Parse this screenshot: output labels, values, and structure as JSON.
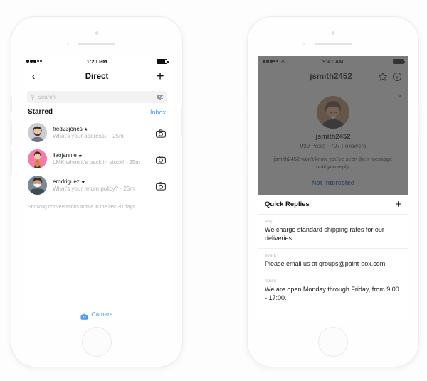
{
  "left_phone": {
    "status_bar": {
      "signal": "•••○○",
      "time": "1:20 PM",
      "battery": "battery-full"
    },
    "nav": {
      "back_icon": "chevron-left",
      "title": "Direct",
      "add_icon": "plus"
    },
    "search": {
      "placeholder": "Search",
      "value": "",
      "icon": "search-icon",
      "filter_icon": "tune-icon"
    },
    "section": {
      "title": "Starred",
      "link": "Inbox"
    },
    "conversations": [
      {
        "username": "fred23jones",
        "star": "★",
        "preview": "What's your address? · 25m",
        "action_icon": "camera-icon"
      },
      {
        "username": "liaojannie",
        "star": "★",
        "preview": "LMK when it's back in stock! · 25m",
        "action_icon": "camera-icon"
      },
      {
        "username": "erodriguez",
        "star": "★",
        "preview": "What's your return policy? · 25m",
        "action_icon": "camera-icon"
      }
    ],
    "footnote": "Showing conversations active in the last 30 days.",
    "bottom_bar": {
      "icon": "camera-icon",
      "label": "Camera"
    }
  },
  "right_phone": {
    "status_bar": {
      "signal": "•••○○",
      "wifi": "wifi-icon",
      "time": "9:41 AM",
      "battery": "battery-full"
    },
    "nav": {
      "title": "jsmith2452",
      "star_icon": "star-outline-icon",
      "info_icon": "info-circle-icon"
    },
    "profile": {
      "close_icon": "close-icon",
      "avatar": "profile-avatar",
      "name": "jsmith2452",
      "stats": "999 Posts  ·  707 Followers",
      "note": "jsmith2452 won't know you've seen their message until you reply.",
      "action": "Not interested"
    },
    "quick_replies": {
      "title": "Quick Replies",
      "add_icon": "plus",
      "items": [
        {
          "key": "ship",
          "body": "We charge standard shipping rates for our deliveries."
        },
        {
          "key": "event",
          "body": "Please email us at groups@paint-box.com."
        },
        {
          "key": "hours",
          "body": "We are open Monday through Friday, from 9:00 - 17:00."
        }
      ]
    }
  },
  "colors": {
    "accent_blue": "#4a9af5",
    "action_blue": "#1f5fbf",
    "muted": "#b0b0b0",
    "overlay": "rgba(66,66,66,0.70)"
  }
}
